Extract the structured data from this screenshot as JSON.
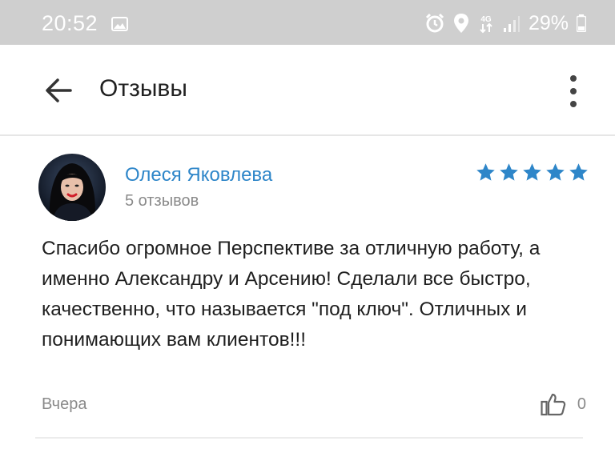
{
  "status_bar": {
    "time": "20:52",
    "network": "4G",
    "battery": "29%"
  },
  "app_bar": {
    "title": "Отзывы"
  },
  "review": {
    "author_name": "Олеся Яковлева",
    "author_reviews": "5 отзывов",
    "rating": 5,
    "rating_color": "#2e86c9",
    "text": "Спасибо огромное Перспективе за отличную работу, а именно Александру и Арсению! Сделали все быстро, качественно, что называется \"под ключ\". Отличных и понимающих вам клиентов!!!",
    "date": "Вчера",
    "likes": "0"
  }
}
